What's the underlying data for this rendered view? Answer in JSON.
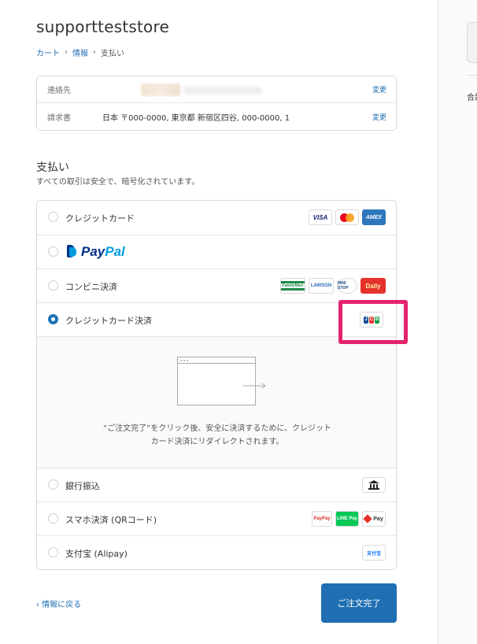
{
  "store": {
    "name": "supporttest​store"
  },
  "breadcrumb": {
    "cart": "カート",
    "info": "情報",
    "payment": "支払い",
    "chevron": "›"
  },
  "summary": {
    "contact_label": "連絡先",
    "contact_change": "変更",
    "billing_label": "請求書",
    "billing_value": "日本 〒000-0000, 東京都 新宿区四谷, 000-0000, 1",
    "billing_change": "変更"
  },
  "payment": {
    "title": "支払い",
    "subtitle": "すべての取引は安全で、暗号化されています。",
    "methods": [
      {
        "label": "クレジットカード",
        "selected": false,
        "icons": [
          "visa-icon",
          "mastercard-icon",
          "amex-icon"
        ]
      },
      {
        "label": "PayPal",
        "selected": false,
        "icons": []
      },
      {
        "label": "コンビニ決済",
        "selected": false,
        "icons": [
          "familymart-icon",
          "lawson-icon",
          "ministop-icon",
          "daily-icon"
        ]
      },
      {
        "label": "クレジットカード決済",
        "selected": true,
        "icons": [
          "jcb-icon"
        ]
      },
      {
        "label": "銀行振込",
        "selected": false,
        "icons": [
          "bank-icon"
        ]
      },
      {
        "label": "スマホ決済 (QRコード)",
        "selected": false,
        "icons": [
          "paypay-icon",
          "linepay-icon",
          "merpay-icon"
        ]
      },
      {
        "label": "支付宝 (Alipay)",
        "selected": false,
        "icons": [
          "alipay-icon"
        ]
      }
    ],
    "card_text": {
      "visa": "VISA",
      "amex": "AMEX",
      "familymart": "FamilyMart",
      "lawson": "LAWSON",
      "ministop": "MINI STOP",
      "daily": "Daily",
      "jcb_j": "J",
      "jcb_c": "C",
      "jcb_b": "B",
      "paypay": "PayPay",
      "linepay": "LINE Pay",
      "merpay": "Pay",
      "alipay": "支付宝"
    },
    "paypal_pay": "Pay",
    "paypal_pal": "Pal",
    "redirect_line1": "“ご注文完了”をクリック後、安全に決済するために、クレジット",
    "redirect_line2": "カード決済にリダイレクトされます。"
  },
  "footer": {
    "back_label": "‹ 情報に戻る",
    "complete_label": "ご注文完了"
  },
  "sidebar": {
    "total_label": "合計"
  },
  "colors": {
    "accent": "#1f6fb2",
    "highlight": "#e4236e"
  }
}
